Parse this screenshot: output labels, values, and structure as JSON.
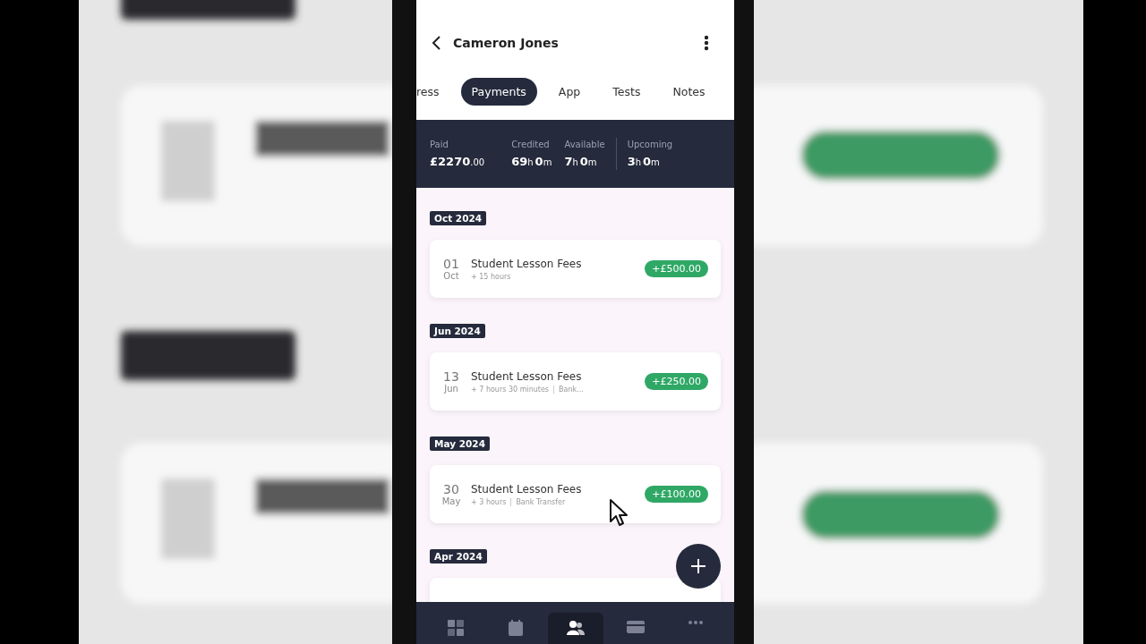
{
  "header": {
    "title": "Cameron Jones"
  },
  "tabs": [
    {
      "label": "ress",
      "selected": false
    },
    {
      "label": "Payments",
      "selected": true
    },
    {
      "label": "App",
      "selected": false
    },
    {
      "label": "Tests",
      "selected": false
    },
    {
      "label": "Notes",
      "selected": false
    }
  ],
  "summary": [
    {
      "kind": "stat",
      "label": "Paid",
      "parts": [
        {
          "text": "£2270",
          "kind": "big"
        },
        {
          "text": ".00",
          "kind": "small"
        }
      ]
    },
    {
      "kind": "stat",
      "label": "Credited",
      "parts": [
        {
          "text": "69",
          "kind": "big"
        },
        {
          "text": "h",
          "kind": "small"
        },
        {
          "text": "0",
          "kind": "big"
        },
        {
          "text": "m",
          "kind": "small"
        }
      ]
    },
    {
      "kind": "stat",
      "label": "Available",
      "parts": [
        {
          "text": "7",
          "kind": "big"
        },
        {
          "text": "h",
          "kind": "small"
        },
        {
          "text": "0",
          "kind": "big"
        },
        {
          "text": "m",
          "kind": "small"
        }
      ]
    },
    {
      "kind": "divider"
    },
    {
      "kind": "stat",
      "label": "Upcoming",
      "parts": [
        {
          "text": "3",
          "kind": "big"
        },
        {
          "text": "h",
          "kind": "small"
        },
        {
          "text": "0",
          "kind": "big"
        },
        {
          "text": "m",
          "kind": "small"
        }
      ]
    }
  ],
  "groups": [
    {
      "month": "Oct 2024",
      "entries": [
        {
          "day": "01",
          "month": "Oct",
          "title": "Student Lesson Fees",
          "details": [
            "+ 15 hours"
          ],
          "amount": "+£500.00"
        }
      ]
    },
    {
      "month": "Jun 2024",
      "entries": [
        {
          "day": "13",
          "month": "Jun",
          "title": "Student Lesson Fees",
          "details": [
            "+ 7 hours 30 minutes",
            "Bank..."
          ],
          "amount": "+£250.00"
        }
      ]
    },
    {
      "month": "May 2024",
      "entries": [
        {
          "day": "30",
          "month": "May",
          "title": "Student Lesson Fees",
          "details": [
            "+ 3 hours",
            "Bank Transfer"
          ],
          "amount": "+£100.00"
        }
      ]
    },
    {
      "month": "Apr 2024",
      "clipped_card": true
    }
  ],
  "fab": {
    "kind": "plus"
  },
  "cursor": {
    "kind": "arrow"
  },
  "nav": [
    {
      "kind": "grid",
      "selected": false
    },
    {
      "kind": "calendar",
      "selected": false
    },
    {
      "kind": "people",
      "selected": true
    },
    {
      "kind": "card",
      "selected": false
    },
    {
      "kind": "dots",
      "selected": false
    }
  ]
}
